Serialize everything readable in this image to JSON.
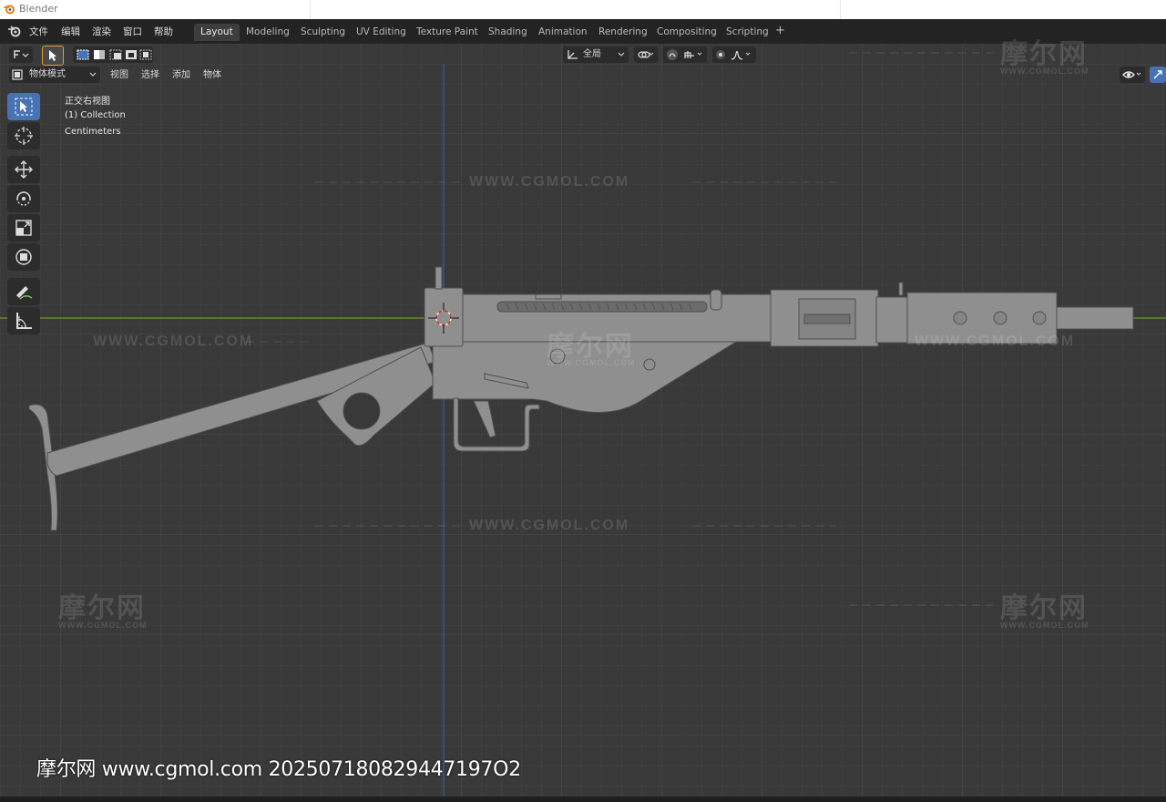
{
  "window": {
    "title": "Blender"
  },
  "menus": [
    "文件",
    "编辑",
    "渲染",
    "窗口",
    "帮助"
  ],
  "workspace_tabs": [
    "Layout",
    "Modeling",
    "Sculpting",
    "UV Editing",
    "Texture Paint",
    "Shading",
    "Animation",
    "Rendering",
    "Compositing",
    "Scripting"
  ],
  "active_tab": "Layout",
  "viewport_header": {
    "mode": "物体模式",
    "menu_items": [
      "视图",
      "选择",
      "添加",
      "物体"
    ],
    "transform_orientation": "全局"
  },
  "viewport_overlay": {
    "view_name": "正交右视图",
    "collection": "(1) Collection",
    "units": "Centimeters"
  },
  "tools": [
    "select-box",
    "cursor",
    "move",
    "rotate",
    "scale",
    "transform",
    "annotate",
    "measure"
  ],
  "watermarks": {
    "logo": "摩尔网",
    "logo_url": "WWW.CGMOL.COM",
    "url": "WWW.CGMOL.COM",
    "bottom_caption": "摩尔网 www.cgmol.com 202507180829447197O2"
  },
  "colors": {
    "viewport_bg": "#393939",
    "active_tool": "#4772b3",
    "x_axis": "#6a9a2a",
    "z_axis": "#3a5a9e",
    "model": "#8f8f8f"
  }
}
